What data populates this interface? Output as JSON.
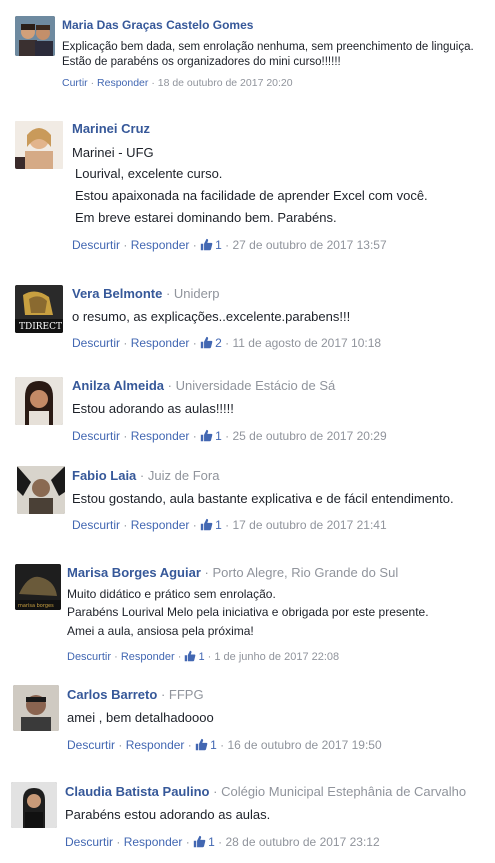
{
  "comments": [
    {
      "name": "Maria Das Graças Castelo Gomes",
      "affiliation": "",
      "lines": [
        "Explicação bem dada, sem enrolação nenhuma, sem preenchimento de linguiça.",
        "Estão de parabéns os organizadores do mini curso!!!!!!"
      ],
      "action1": "Curtir",
      "action2": "Responder",
      "likes": "",
      "date": "18 de outubro de 2017 20:20",
      "avatar_color": "#5a4a3a"
    },
    {
      "name": "Marinei Cruz",
      "affiliation": "",
      "lines": [
        "Marinei - UFG",
        "Lourival, excelente curso.",
        "Estou apaixonada na facilidade de aprender Excel com você.",
        "Em breve estarei dominando bem. Parabéns."
      ],
      "action1": "Descurtir",
      "action2": "Responder",
      "likes": "1",
      "date": "27 de outubro de 2017 13:57",
      "avatar_color": "#c9a27a"
    },
    {
      "name": "Vera Belmonte",
      "affiliation": "Uniderp",
      "lines": [
        "o resumo, as explicações..excelente.parabens!!!"
      ],
      "action1": "Descurtir",
      "action2": "Responder",
      "likes": "2",
      "date": "11 de agosto de 2017 10:18",
      "avatar_color": "#3a3a3a",
      "avatar_text": "TDIRECT"
    },
    {
      "name": "Anilza Almeida",
      "affiliation": "Universidade Estácio de Sá",
      "lines": [
        "Estou adorando as aulas!!!!!"
      ],
      "action1": "Descurtir",
      "action2": "Responder",
      "likes": "1",
      "date": "25 de outubro de 2017 20:29",
      "avatar_color": "#4a3628"
    },
    {
      "name": "Fabio Laia",
      "affiliation": "Juiz de Fora",
      "lines": [
        "Estou gostando, aula bastante explicativa e de fácil entendimento."
      ],
      "action1": "Descurtir",
      "action2": "Responder",
      "likes": "1",
      "date": "17 de outubro de 2017 21:41",
      "avatar_color": "#5c5448"
    },
    {
      "name": "Marisa Borges Aguiar",
      "affiliation": "Porto Alegre, Rio Grande do Sul",
      "lines": [
        "Muito didático e prático sem enrolação.",
        "Parabéns Lourival Melo pela iniciativa e obrigada por este presente.",
        "Amei a aula, ansiosa pela próxima!"
      ],
      "action1": "Descurtir",
      "action2": "Responder",
      "likes": "1",
      "date": "1 de junho de 2017 22:08",
      "avatar_color": "#2e2e2e"
    },
    {
      "name": "Carlos Barreto",
      "affiliation": "FFPG",
      "lines": [
        "amei , bem detalhadoooo"
      ],
      "action1": "Descurtir",
      "action2": "Responder",
      "likes": "1",
      "date": "16 de outubro de 2017 19:50",
      "avatar_color": "#6b5a48"
    },
    {
      "name": "Claudia Batista Paulino",
      "affiliation": "Colégio Municipal Estephânia de Carvalho",
      "lines": [
        "Parabéns estou adorando as aulas."
      ],
      "action1": "Descurtir",
      "action2": "Responder",
      "likes": "1",
      "date": "28 de outubro de 2017 23:12",
      "avatar_color": "#9a9a9a"
    }
  ],
  "separator": "·",
  "icons": {
    "like": "thumbs-up-icon"
  },
  "colors": {
    "name": "#365899",
    "link": "#4267b2",
    "muted": "#90949c",
    "text": "#1d2129"
  }
}
